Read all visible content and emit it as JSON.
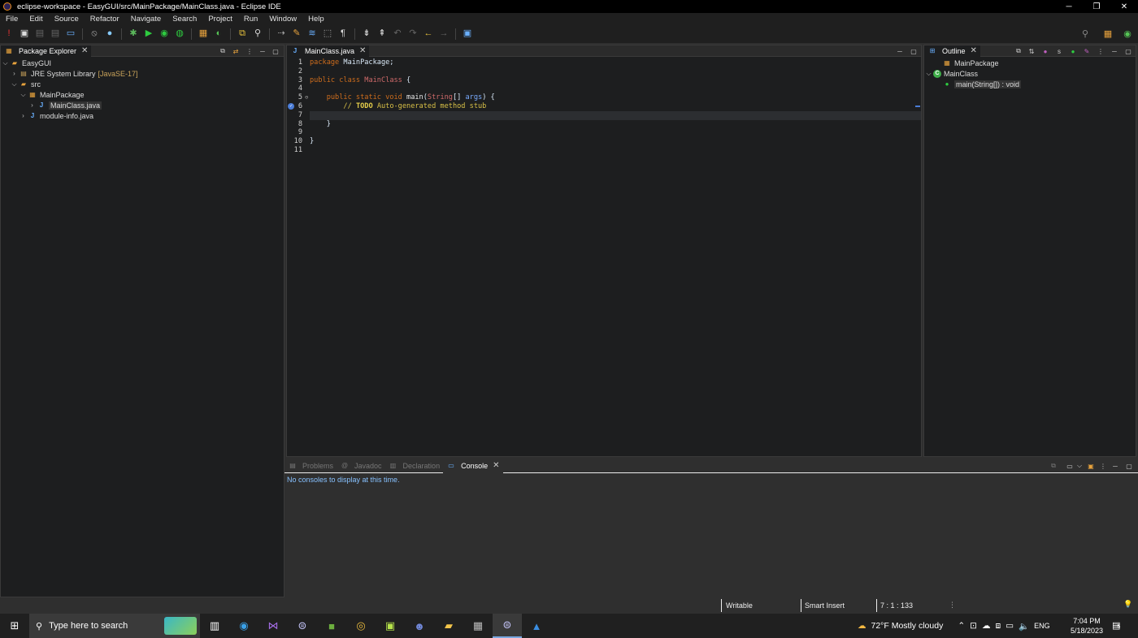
{
  "window": {
    "title": "eclipse-workspace - EasyGUI/src/MainPackage/MainClass.java - Eclipse IDE",
    "minimize": "─",
    "restore": "❐",
    "close": "✕"
  },
  "menu": [
    "File",
    "Edit",
    "Source",
    "Refactor",
    "Navigate",
    "Search",
    "Project",
    "Run",
    "Window",
    "Help"
  ],
  "package_explorer": {
    "title": "Package Explorer",
    "items": [
      {
        "label": "EasyGUI",
        "extra": ""
      },
      {
        "label": "JRE System Library",
        "extra": "[JavaSE-17]"
      },
      {
        "label": "src",
        "extra": ""
      },
      {
        "label": "MainPackage",
        "extra": ""
      },
      {
        "label": "MainClass.java",
        "extra": ""
      },
      {
        "label": "module-info.java",
        "extra": ""
      }
    ]
  },
  "editor": {
    "tab": "MainClass.java",
    "lines": [
      "1",
      "2",
      "3",
      "4",
      "5",
      "6",
      "7",
      "8",
      "9",
      "10",
      "11"
    ],
    "code": {
      "l1_kw": "package",
      "l1_rest": " MainPackage;",
      "l3_kw": "public class",
      "l3_cls": "MainClass",
      "l3_rest": " {",
      "l5_kw": "public static void",
      "l5_meth": "main",
      "l5_open": "(",
      "l5_type": "String",
      "l5_arr": "[] ",
      "l5_param": "args",
      "l5_close": ") {",
      "l6_comment": "// ",
      "l6_todo": "TODO",
      "l6_rest": " Auto-generated method stub",
      "l8": "}",
      "l10": "}"
    }
  },
  "outline": {
    "title": "Outline",
    "items": [
      {
        "label": "MainPackage"
      },
      {
        "label": "MainClass"
      },
      {
        "label": "main(String[]) : void"
      }
    ]
  },
  "bottom": {
    "tabs": [
      "Problems",
      "Javadoc",
      "Declaration",
      "Console"
    ],
    "message": "No consoles to display at this time."
  },
  "status": {
    "writable": "Writable",
    "insert": "Smart Insert",
    "position": "7 : 1 : 133"
  },
  "taskbar": {
    "search_placeholder": "Type here to search",
    "weather": "72°F  Mostly cloudy",
    "lang": "ENG",
    "time": "7:04 PM",
    "date": "5/18/2023",
    "notif": "5"
  }
}
